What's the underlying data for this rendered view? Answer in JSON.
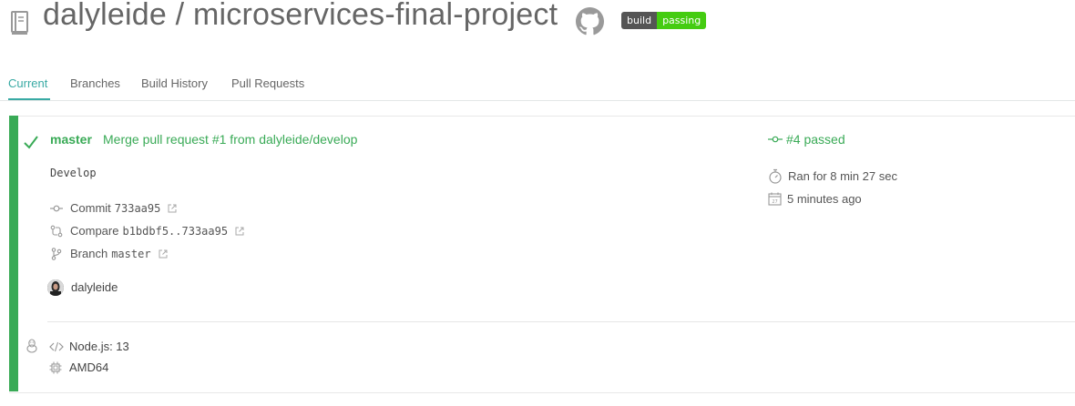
{
  "header": {
    "owner": "dalyleide",
    "separator": " / ",
    "repo": "microservices-final-project",
    "badge": {
      "label": "build",
      "status": "passing"
    }
  },
  "tabs": [
    "Current",
    "Branches",
    "Build History",
    "Pull Requests"
  ],
  "build": {
    "branch": "master",
    "commit_message": "Merge pull request #1 from dalyleide/develop",
    "description": "Develop",
    "commit": {
      "label": "Commit",
      "value": "733aa95"
    },
    "compare": {
      "label": "Compare",
      "value": "b1bdbf5..733aa95"
    },
    "branch_link": {
      "label": "Branch",
      "value": "master"
    },
    "author": "dalyleide",
    "status": "#4 passed",
    "duration": "Ran for 8 min 27 sec",
    "finished": "5 minutes ago",
    "language": "Node.js: 13",
    "arch": "AMD64"
  },
  "colors": {
    "passed": "#39aa56",
    "tab_active": "#39aaa4",
    "badge_left": "#555555",
    "badge_right": "#44cc11"
  }
}
